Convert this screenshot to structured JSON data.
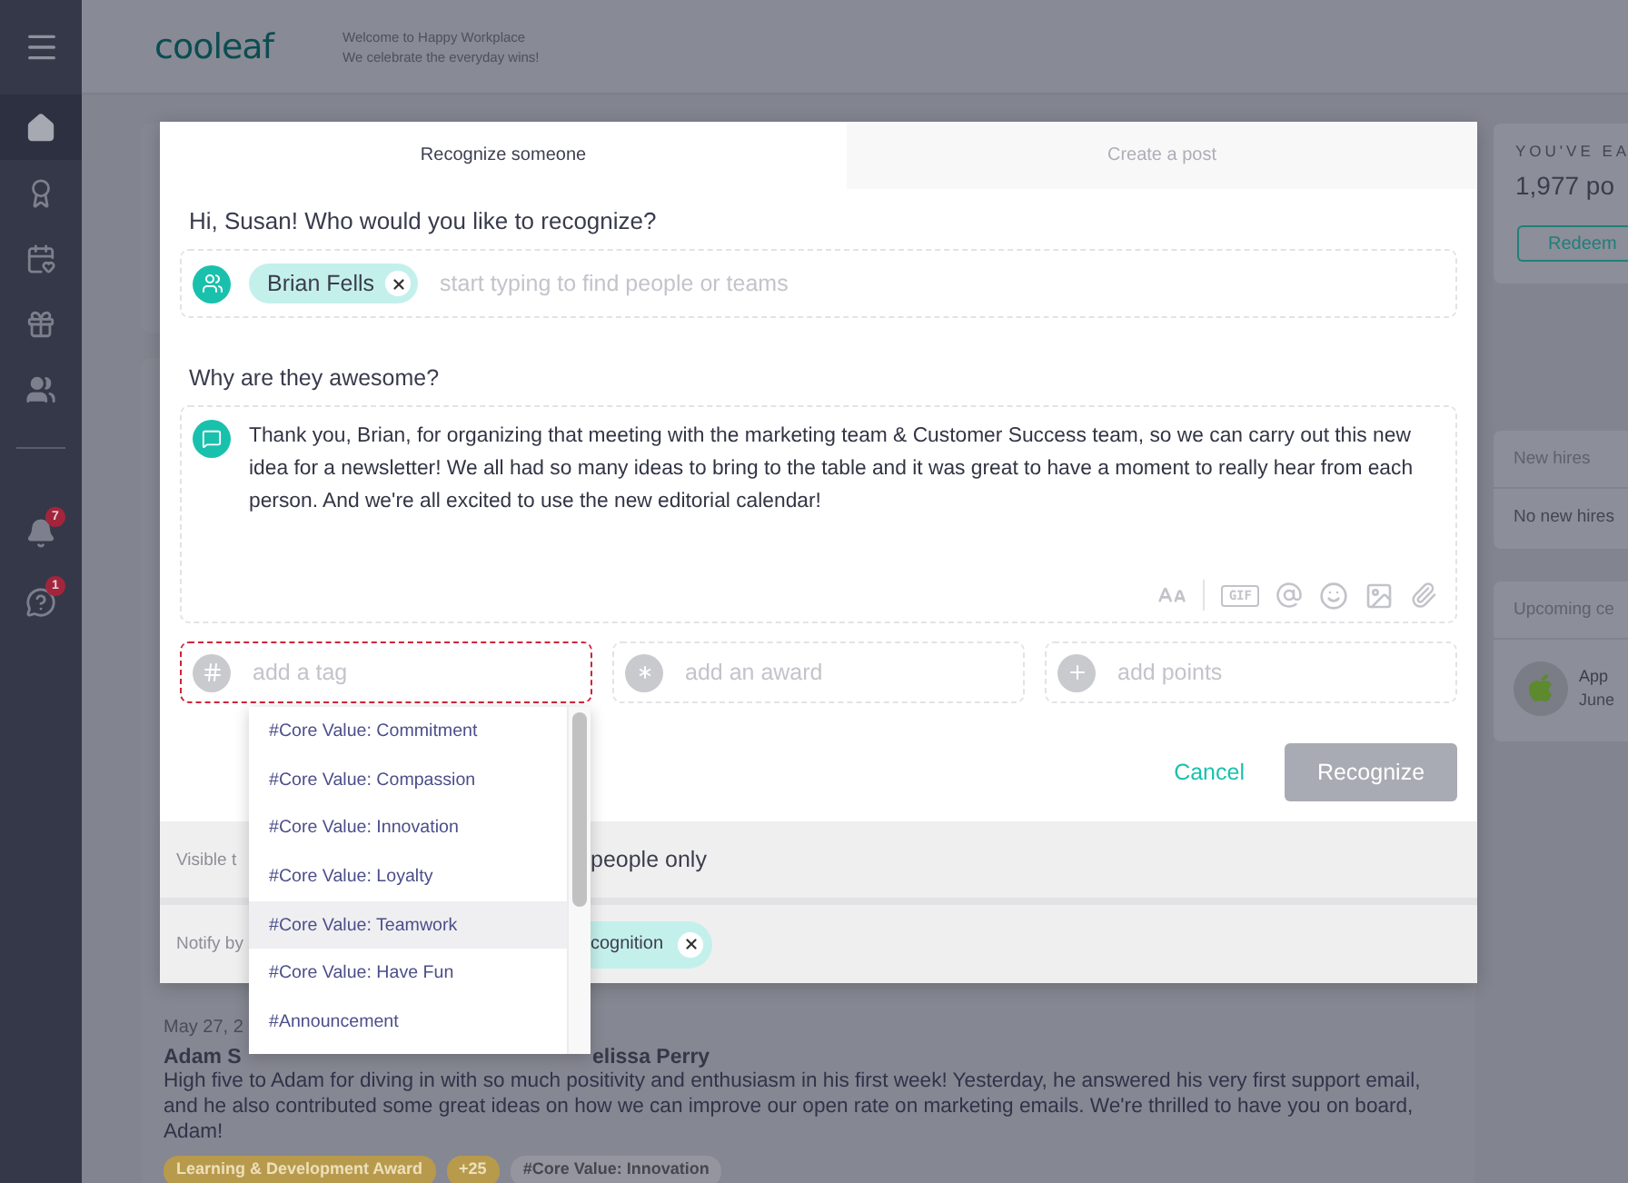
{
  "sidebar": {
    "items": [
      {
        "kind": "home",
        "selected": true
      },
      {
        "kind": "awards",
        "selected": false
      },
      {
        "kind": "events",
        "selected": false
      },
      {
        "kind": "rewards",
        "selected": false
      },
      {
        "kind": "people",
        "selected": false
      },
      {
        "kind": "notifications",
        "selected": false,
        "badge": "7"
      },
      {
        "kind": "help",
        "selected": false,
        "badge": "1"
      }
    ]
  },
  "header": {
    "logo": "cooleaf",
    "tagline": [
      "Welcome to Happy Workplace",
      "We celebrate the everyday wins!"
    ]
  },
  "feed": {
    "post": {
      "date": "May 27, 2",
      "author": "Adam S",
      "recognizer": "elissa Perry",
      "body": "High five to Adam for diving in with so much positivity and enthusiasm in his first week! Yesterday, he answered his very first support email, and he also contributed some great ideas on how we can improve our open rate on marketing emails. We're thrilled to have you on board, Adam!",
      "tags": [
        {
          "label": "Learning & Development Award",
          "color": "#b89a4c"
        },
        {
          "label": "+25",
          "color": "#b89a4c"
        },
        {
          "label": "#Core Value: Innovation",
          "color": "#94959f"
        }
      ]
    }
  },
  "right_panel": {
    "points_card": {
      "heading": "YOU'VE EA",
      "points": "1,977 po",
      "button": "Redeem"
    },
    "new_hires_card": {
      "title": "New hires",
      "empty": "No new hires"
    },
    "celebrations_card": {
      "title": "Upcoming ce",
      "event": {
        "name": "App",
        "date": "June"
      }
    }
  },
  "modal": {
    "tabs": [
      {
        "label": "Recognize someone",
        "selected": true
      },
      {
        "label": "Create a post",
        "selected": false
      }
    ],
    "question": "Hi, Susan! Who would you like to recognize?",
    "recipients": {
      "chips": [
        "Brian Fells"
      ],
      "placeholder": "start typing to find people or teams"
    },
    "message_label": "Why are they awesome?",
    "message": "Thank you, Brian, for organizing that meeting with the marketing team & Customer Success team, so we can carry out this new idea for a newsletter! We all had so many ideas to bring to the table and it was great to have a moment to really hear from each person. And we're all excited to use the new editorial calendar!",
    "toolbar": {
      "gif": "GIF"
    },
    "fields": [
      {
        "kind": "tag",
        "placeholder": "add a tag",
        "focused": true
      },
      {
        "kind": "award",
        "placeholder": "add an award",
        "focused": false
      },
      {
        "kind": "points",
        "placeholder": "add points",
        "focused": false
      }
    ],
    "tag_options": [
      {
        "label": "#Core Value: Commitment",
        "selected": false
      },
      {
        "label": "#Core Value: Compassion",
        "selected": false
      },
      {
        "label": "#Core Value: Innovation",
        "selected": false
      },
      {
        "label": "#Core Value: Loyalty",
        "selected": false
      },
      {
        "label": "#Core Value: Teamwork",
        "selected": true
      },
      {
        "label": "#Core Value: Have Fun",
        "selected": false
      },
      {
        "label": "#Announcement",
        "selected": false
      }
    ],
    "cancel": "Cancel",
    "submit": {
      "label": "Recognize",
      "disabled": true
    },
    "visibility": {
      "label": "Visible t",
      "value": "people only"
    },
    "notify": {
      "label": "Notify by",
      "chip": "cognition"
    }
  }
}
